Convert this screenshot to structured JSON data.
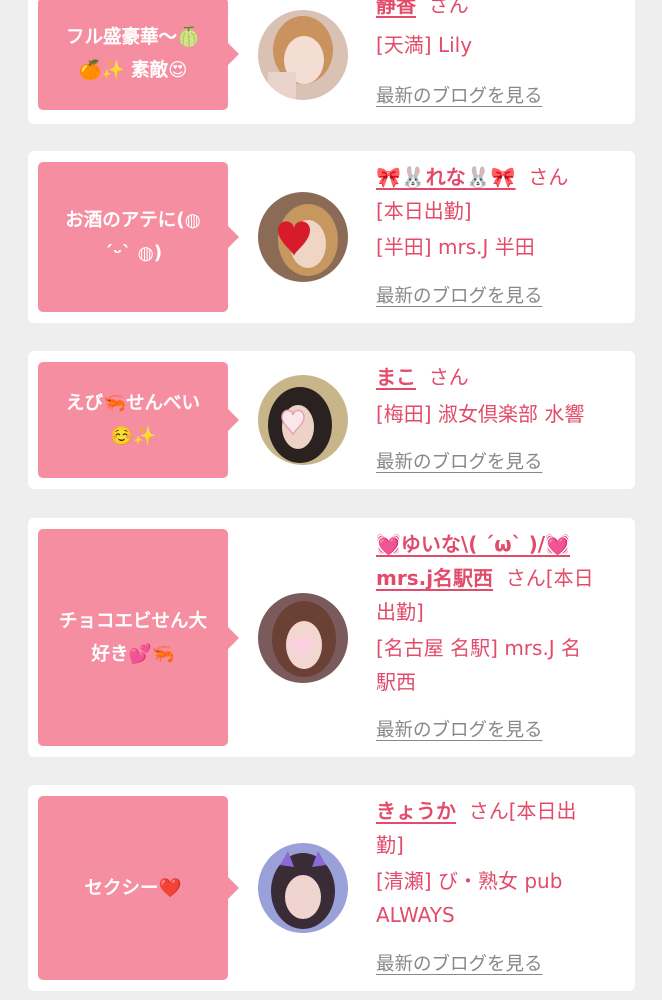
{
  "colors": {
    "page_background": "#eeeeee",
    "card_background": "#ffffff",
    "bubble_pink": "#f68ea1",
    "accent_text": "#e24c6a",
    "link_gray": "#888888"
  },
  "san_label": "さん",
  "blog_link_label": "最新のブログを見る",
  "cards": [
    {
      "comment_lines": [
        "フル盛豪華〜🍈",
        "🍊✨ 素敵😍"
      ],
      "name": "静香",
      "name_suffix": "さん",
      "shop_lines": [
        "[天満] Lily"
      ],
      "avatar_icon": "avatar-photo-icon"
    },
    {
      "comment_lines": [
        "お酒のアテに(◍",
        "´ᵕ` ◍)"
      ],
      "name": "🎀🐰れな🐰🎀",
      "name_suffix": "さん",
      "shop_lines": [
        "[本日出勤]",
        "[半田] mrs.J 半田"
      ],
      "avatar_icon": "avatar-photo-icon"
    },
    {
      "comment_lines": [
        "えび🦐せんべい",
        "☺️✨"
      ],
      "name": "まこ",
      "name_suffix": "さん",
      "shop_lines": [
        "[梅田] 淑女倶楽部 水響"
      ],
      "avatar_icon": "avatar-photo-icon"
    },
    {
      "comment_lines": [
        "チョコエビせん大",
        "好き💕🦐"
      ],
      "name_lines": [
        "💓ゆいな\\( ´ω` )/💓",
        "mrs.j名駅西"
      ],
      "name_suffix_lines": [
        "さん[本日",
        "出勤]"
      ],
      "shop_lines": [
        "[名古屋 名駅] mrs.J 名",
        "駅西"
      ],
      "avatar_icon": "avatar-photo-icon"
    },
    {
      "comment_lines": [
        "セクシー❤️"
      ],
      "name": "きょうか",
      "name_suffix_lines": [
        "さん[本日出",
        "勤]"
      ],
      "shop_lines": [
        "[清瀬] び・熟女 pub",
        "ALWAYS"
      ],
      "avatar_icon": "avatar-photo-icon"
    }
  ]
}
